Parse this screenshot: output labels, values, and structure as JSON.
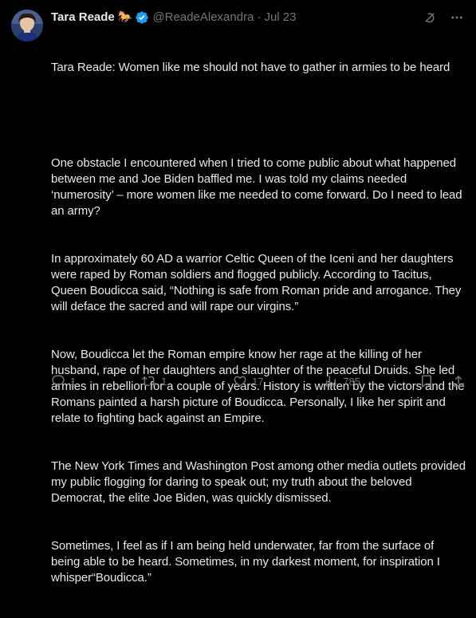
{
  "author": {
    "display_name": "Tara Reade",
    "badge_emoji": "🐎",
    "verified": true,
    "handle": "@ReadeAlexandra",
    "separator": "·",
    "date": "Jul 23"
  },
  "tweet": {
    "title_line": "Tara Reade: Women like me should not have to gather in armies to be heard",
    "paragraph_1": "One obstacle I encountered when I tried to come public about what happened between me and Joe Biden baffled me. I was told my claims needed ‘numerosity’ – more women like me needed to come forward. Do I need to lead an army?",
    "paragraph_2": "In approximately 60 AD a warrior Celtic Queen of the Iceni and her daughters were raped by Roman soldiers and flogged publicly. According to Tacitus, Queen Boudicca said, “Nothing is safe from Roman pride and arrogance. They will deface the sacred and will rape our virgins.”",
    "paragraph_3": "Now, Boudicca let the Roman empire know her rage at the killing of her husband, rape of her daughters and slaughter of the peaceful Druids. She led armies in rebellion for a couple of years. History is written by the victors and the Romans painted a harsh picture of Boudicca. Personally, I like her spirit and relate to fighting back against an Empire.",
    "paragraph_4": "The New York Times and Washington Post among other media outlets provided my public flogging for daring to speak out; my truth about the beloved Democrat, the elite Joe Biden, was quickly dismissed.",
    "paragraph_5": "Sometimes, I feel as if I am being held underwater, far from the surface of being able to be heard. Sometimes, in my darkest moment, for inspiration I whisper“Boudicca.”"
  },
  "actions": {
    "replies": "1",
    "reposts": "1",
    "likes": "17",
    "views": "785"
  },
  "icons": {
    "header": [
      "grok-icon",
      "more-icon"
    ],
    "actions": [
      "reply-icon",
      "repost-icon",
      "like-icon",
      "views-icon",
      "bookmark-icon",
      "share-icon"
    ]
  },
  "colors": {
    "background": "#000000",
    "text": "#e7e9ea",
    "muted": "#71767b",
    "verified_blue": "#1d9bf0"
  }
}
